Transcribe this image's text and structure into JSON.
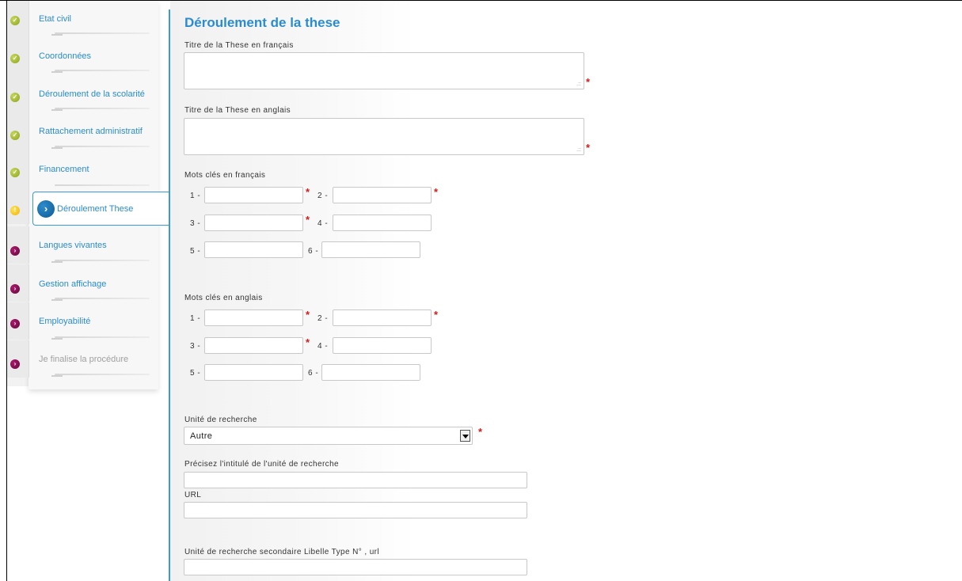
{
  "sidebar": {
    "steps": [
      {
        "label": "Etat civil",
        "status": "done"
      },
      {
        "label": "Coordonnées",
        "status": "done"
      },
      {
        "label": "Déroulement de la scolarité",
        "status": "done"
      },
      {
        "label": "Rattachement administratif",
        "status": "done"
      },
      {
        "label": "Financement",
        "status": "done"
      },
      {
        "label": "Déroulement These",
        "status": "current"
      },
      {
        "label": "Langues vivantes",
        "status": "todo"
      },
      {
        "label": "Gestion affichage",
        "status": "todo"
      },
      {
        "label": "Employabilité",
        "status": "todo"
      },
      {
        "label": "Je finalise la procédure",
        "status": "todo-disabled"
      }
    ]
  },
  "main": {
    "title": "Déroulement de la these",
    "titre_fr_label": "Titre de la These en français",
    "titre_en_label": "Titre de la These en anglais",
    "mots_fr_label": "Mots clés en français",
    "mots_en_label": "Mots clés en anglais",
    "keyword_numbers": [
      "1 -",
      "2 -",
      "3 -",
      "4 -",
      "5 -",
      "6 -"
    ],
    "unite_label": "Unité de recherche",
    "unite_selected": "Autre",
    "precisez_label": "Précisez l'intitulé de l'unité de recherche",
    "url_label": "URL",
    "unite_secondaire_label": "Unité de recherche secondaire Libelle Type N° , url",
    "required_mark": "*",
    "resize_grip": ".::"
  },
  "colors": {
    "accent": "#2a8ccf",
    "required": "#d21a1a",
    "step_done": "#8fa21c",
    "step_warn": "#f0b400",
    "step_todo": "#7a0d4e"
  }
}
